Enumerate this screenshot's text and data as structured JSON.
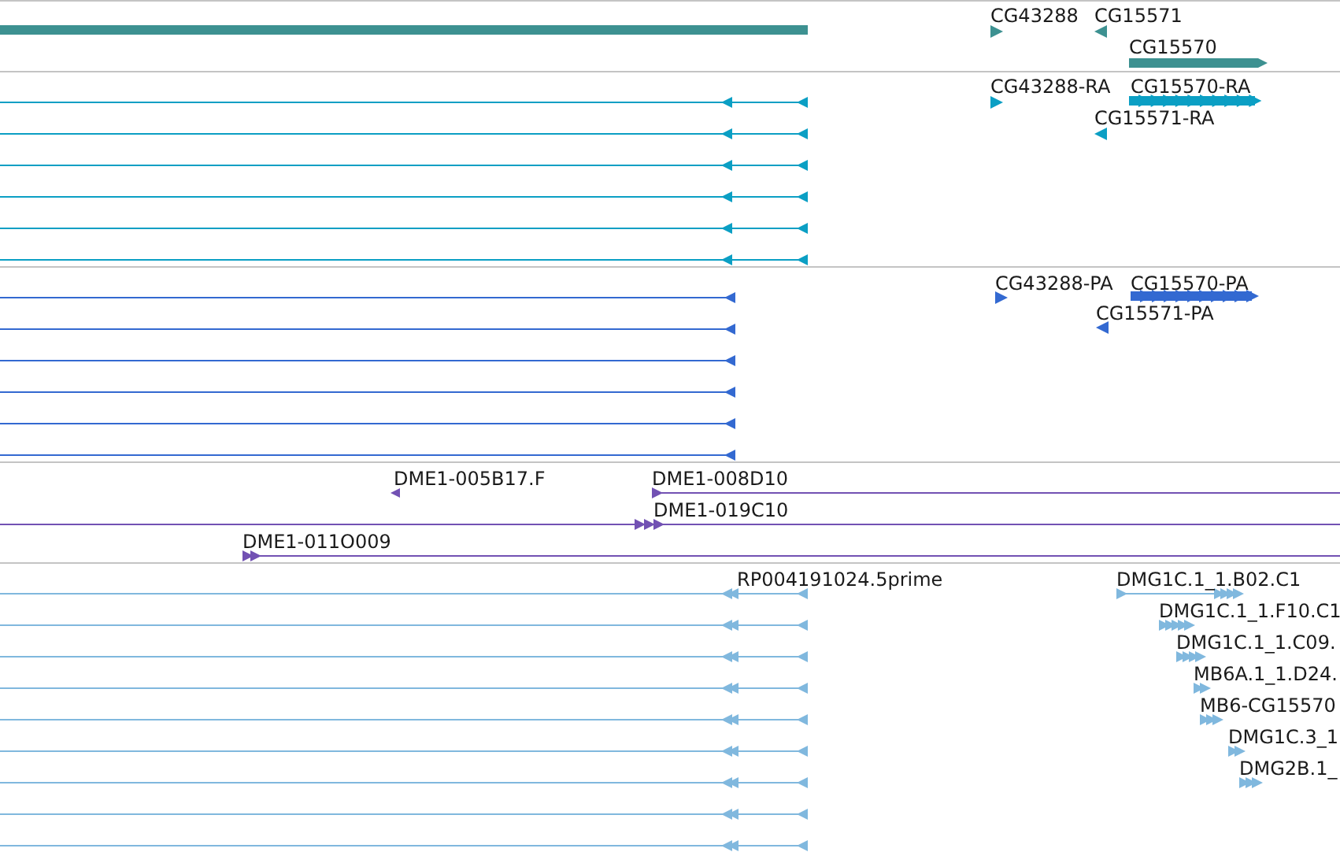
{
  "tracks": [
    {
      "color": "#3d9191",
      "features": [
        {
          "label": "CG43288"
        },
        {
          "label": "CG15571"
        },
        {
          "label": "CG15570"
        }
      ]
    },
    {
      "color": "#0b9fc4",
      "features": [
        {
          "label": "CG43288-RA"
        },
        {
          "label": "CG15570-RA"
        },
        {
          "label": "CG15571-RA"
        }
      ]
    },
    {
      "color": "#3369d1",
      "features": [
        {
          "label": "CG43288-PA"
        },
        {
          "label": "CG15570-PA"
        },
        {
          "label": "CG15571-PA"
        }
      ]
    },
    {
      "color": "#7251b3",
      "features": [
        {
          "label": "DME1-005B17.F"
        },
        {
          "label": "DME1-008D10"
        },
        {
          "label": "DME1-019C10"
        },
        {
          "label": "DME1-011O009"
        }
      ]
    },
    {
      "color": "#80b8de",
      "features": [
        {
          "label": "RP004191024.5prime"
        },
        {
          "label": "DMG1C.1_1.B02.C1"
        },
        {
          "label": "DMG1C.1_1.F10.C1"
        },
        {
          "label": "DMG1C.1_1.C09."
        },
        {
          "label": "MB6A.1_1.D24."
        },
        {
          "label": "MB6-CG15570"
        },
        {
          "label": "DMG1C.3_1"
        },
        {
          "label": "DMG2B.1_"
        }
      ]
    }
  ]
}
